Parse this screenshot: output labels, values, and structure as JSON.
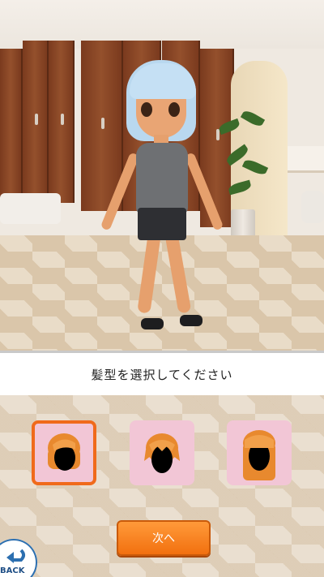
{
  "prompt": {
    "text": "髪型を選択してください"
  },
  "hair_options": [
    {
      "id": "hair-bob",
      "selected": true,
      "icon": "short-bob-hair-icon"
    },
    {
      "id": "hair-short",
      "selected": false,
      "icon": "short-layered-hair-icon"
    },
    {
      "id": "hair-long",
      "selected": false,
      "icon": "long-straight-hair-icon"
    }
  ],
  "next_button": {
    "label": "次へ"
  },
  "back_button": {
    "label": "BACK"
  },
  "colors": {
    "accent": "#f06a1b",
    "option_bg": "#f2c6d6",
    "hair_orange": "#e8892e",
    "character_hair": "#c5e0f4"
  }
}
